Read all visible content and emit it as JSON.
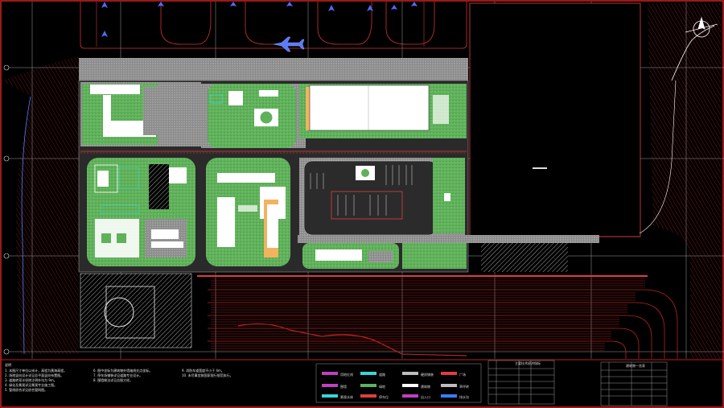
{
  "drawing": {
    "title": "",
    "colors": {
      "background": "#000000",
      "frame": "#ff2a2a",
      "grid": "#d8d8d8",
      "green_area": "#5fb15a",
      "paving": "#9a9a9a",
      "building": "#ffffff",
      "road_line": "#e23d3d",
      "drainage": "#3c7cff",
      "highlight": "#f2b35f",
      "accent_cyan": "#38d6d6",
      "accent_magenta": "#c040c0"
    },
    "icons": [
      "aircraft-icon",
      "north-arrow-icon",
      "helipad-icon"
    ]
  },
  "notes": {
    "heading": "说明",
    "col1": [
      "1. 本图尺寸单位以米计，高程为黄海高程。",
      "2. 场地竖向设计详见总平面竖向布置图。",
      "3. 道路转弯半径除注明外均为 9m。",
      "4. 绿化及景观详见景观专业施工图。",
      "5. 管线综合详见综合管网图。"
    ],
    "col2": [
      "6. 图中坐标为建筑物外墙轴线交点坐标。",
      "7. 停车场铺装详见道路专业设计。",
      "8. 围墙做法详见总图大样。"
    ],
    "col3": [
      "9. 消防车道宽度不小于 4m。",
      "10. 未尽事宜按国家现行规范执行。"
    ]
  },
  "legend": {
    "items": [
      {
        "label": "用地红线",
        "color": "#c040c0"
      },
      {
        "label": "道路",
        "color": "#38d6d6"
      },
      {
        "label": "绿地",
        "color": "#5fb15a"
      },
      {
        "label": "硬质铺装",
        "color": "#bdbdbd"
      },
      {
        "label": "建筑物",
        "color": "#ffffff"
      },
      {
        "label": "停车位",
        "color": "#e23d3d"
      },
      {
        "label": "围墙",
        "color": "#c040c0"
      },
      {
        "label": "排水沟",
        "color": "#3c7cff"
      },
      {
        "label": "草坪砖",
        "color": "#bdbdbd"
      },
      {
        "label": "景观水体",
        "color": "#38d6d6"
      },
      {
        "label": "出入口",
        "color": "#e23d3d"
      },
      {
        "label": "广场",
        "color": "#bdbdbd"
      }
    ]
  },
  "tables": {
    "table1_title": "主要技术经济指标",
    "table2_title": "建筑物一览表"
  }
}
